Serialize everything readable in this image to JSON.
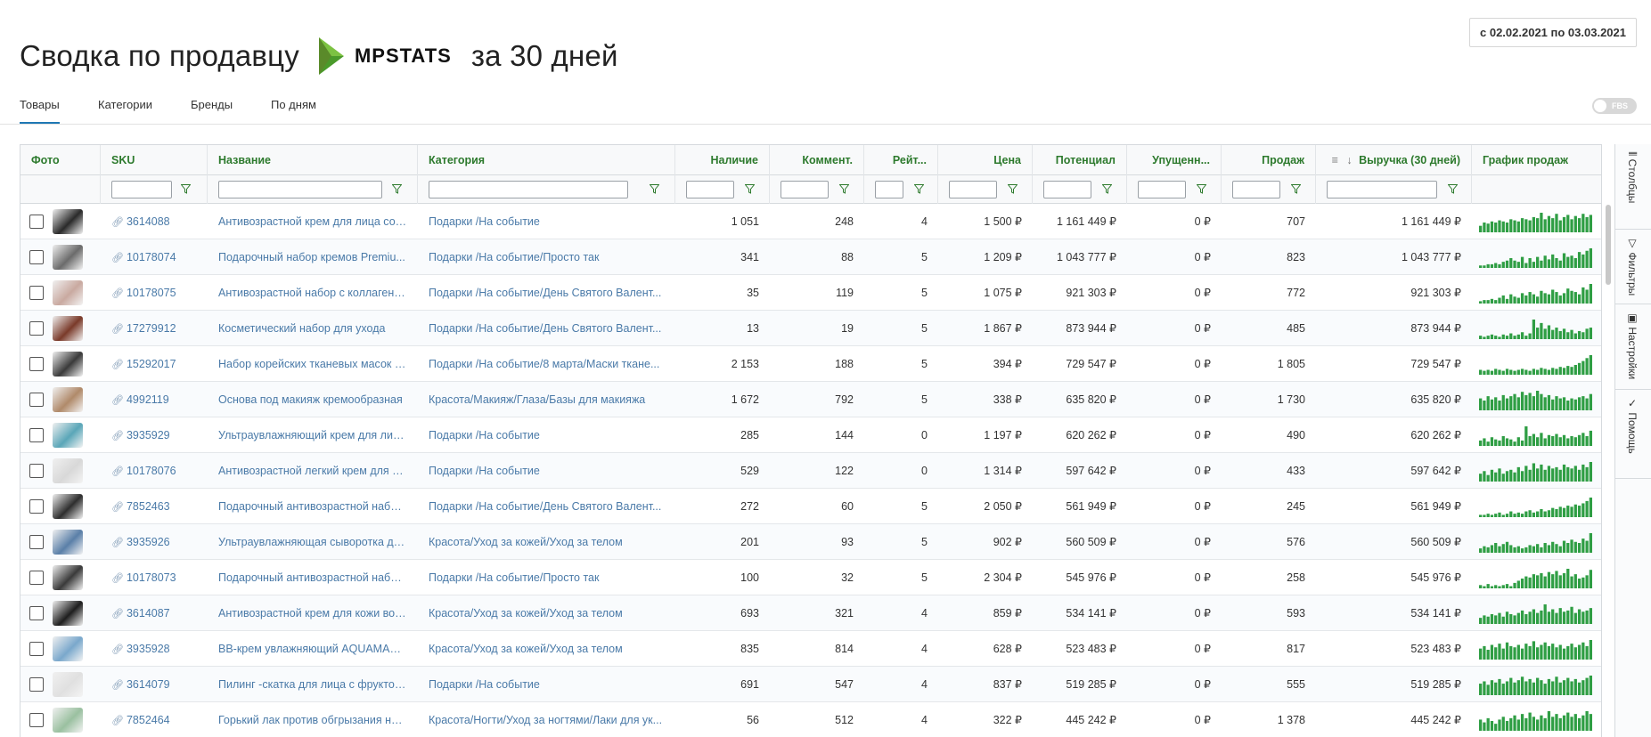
{
  "header": {
    "title_prefix": "Сводка по продавцу",
    "logo_text": "MPSTATS",
    "title_suffix": "за 30 дней",
    "date_range": "с 02.02.2021 по 03.03.2021"
  },
  "tabs": [
    {
      "label": "Товары",
      "active": true
    },
    {
      "label": "Категории",
      "active": false
    },
    {
      "label": "Бренды",
      "active": false
    },
    {
      "label": "По дням",
      "active": false
    }
  ],
  "fbs_toggle": {
    "label": "FBS",
    "on": false
  },
  "columns": {
    "photo": "Фото",
    "sku": "SKU",
    "name": "Название",
    "category": "Категория",
    "stock": "Наличие",
    "comments": "Коммент.",
    "rating": "Рейт...",
    "price": "Цена",
    "potential": "Потенциал",
    "lost": "Упущенн...",
    "sales": "Продаж",
    "revenue": "Выручка (30 дней)",
    "chart": "График продаж"
  },
  "side_panel": {
    "columns": "Столбцы",
    "filters": "Фильтры",
    "settings": "Настройки",
    "help": "Помощь"
  },
  "colors": {
    "accent_green": "#2f9e44",
    "header_green": "#2d7a2d",
    "link_blue": "#4a7aa8",
    "tab_underline": "#1f78b4"
  },
  "rows": [
    {
      "sku": "3614088",
      "name": "Антивозрастной крем для лица со з...",
      "category": "Подарки /На событие",
      "stock": "1 051",
      "comments": "248",
      "rating": "4",
      "price": "1 500 ₽",
      "potential": "1 161 449 ₽",
      "lost": "0 ₽",
      "sales": "707",
      "revenue": "1 161 449 ₽",
      "photo_color": "#2a2a2a",
      "spark": [
        6,
        9,
        8,
        10,
        9,
        11,
        10,
        9,
        12,
        11,
        10,
        13,
        12,
        11,
        14,
        13,
        18,
        12,
        15,
        13,
        17,
        11,
        14,
        16,
        12,
        15,
        13,
        17,
        14,
        16
      ]
    },
    {
      "sku": "10178074",
      "name": "Подарочный набор кремов Premiu...",
      "category": "Подарки /На событие/Просто так",
      "stock": "341",
      "comments": "88",
      "rating": "5",
      "price": "1 209 ₽",
      "potential": "1 043 777 ₽",
      "lost": "0 ₽",
      "sales": "823",
      "revenue": "1 043 777 ₽",
      "photo_color": "#6b6b6b",
      "spark": [
        2,
        2,
        3,
        3,
        4,
        3,
        5,
        6,
        8,
        6,
        5,
        9,
        4,
        8,
        5,
        9,
        6,
        10,
        7,
        11,
        8,
        6,
        12,
        9,
        10,
        8,
        13,
        11,
        14,
        16
      ]
    },
    {
      "sku": "10178075",
      "name": "Антивозрастной набор с коллагено...",
      "category": "Подарки /На событие/День Святого Валент...",
      "stock": "35",
      "comments": "119",
      "rating": "5",
      "price": "1 075 ₽",
      "potential": "921 303 ₽",
      "lost": "0 ₽",
      "sales": "772",
      "revenue": "921 303 ₽",
      "photo_color": "#c9a9a0",
      "spark": [
        2,
        3,
        3,
        4,
        3,
        5,
        7,
        4,
        8,
        6,
        5,
        9,
        7,
        10,
        8,
        6,
        11,
        9,
        8,
        12,
        10,
        7,
        9,
        13,
        11,
        10,
        8,
        14,
        12,
        17
      ]
    },
    {
      "sku": "17279912",
      "name": "Косметический набор для ухода",
      "category": "Подарки /На событие/День Святого Валент...",
      "stock": "13",
      "comments": "19",
      "rating": "5",
      "price": "1 867 ₽",
      "potential": "873 944 ₽",
      "lost": "0 ₽",
      "sales": "485",
      "revenue": "873 944 ₽",
      "photo_color": "#7a3a2a",
      "spark": [
        3,
        2,
        3,
        4,
        3,
        2,
        4,
        3,
        5,
        3,
        4,
        6,
        3,
        5,
        17,
        10,
        14,
        9,
        12,
        8,
        10,
        7,
        9,
        6,
        8,
        5,
        7,
        6,
        9,
        10
      ]
    },
    {
      "sku": "15292017",
      "name": "Набор корейских тканевых масок Ас...",
      "category": "Подарки /На событие/8 марта/Маски ткане...",
      "stock": "2 153",
      "comments": "188",
      "rating": "5",
      "price": "394 ₽",
      "potential": "729 547 ₽",
      "lost": "0 ₽",
      "sales": "1 805",
      "revenue": "729 547 ₽",
      "photo_color": "#3a3a3a",
      "spark": [
        5,
        4,
        5,
        4,
        6,
        5,
        4,
        6,
        5,
        4,
        5,
        6,
        5,
        4,
        6,
        5,
        7,
        6,
        5,
        7,
        6,
        8,
        7,
        9,
        8,
        10,
        12,
        14,
        17,
        20
      ]
    },
    {
      "sku": "4992119",
      "name": "Основа под макияж кремообразная",
      "category": "Красота/Макияж/Глаза/Базы для макияжа",
      "stock": "1 672",
      "comments": "792",
      "rating": "5",
      "price": "338 ₽",
      "potential": "635 820 ₽",
      "lost": "0 ₽",
      "sales": "1 730",
      "revenue": "635 820 ₽",
      "photo_color": "#b08a6a",
      "spark": [
        11,
        9,
        13,
        10,
        12,
        9,
        14,
        11,
        13,
        15,
        12,
        17,
        14,
        16,
        13,
        18,
        15,
        12,
        14,
        10,
        13,
        11,
        12,
        9,
        11,
        10,
        12,
        13,
        11,
        15
      ]
    },
    {
      "sku": "3935929",
      "name": "Ультраувлажняющий крем для лица...",
      "category": "Подарки /На событие",
      "stock": "285",
      "comments": "144",
      "rating": "0",
      "price": "1 197 ₽",
      "potential": "620 262 ₽",
      "lost": "0 ₽",
      "sales": "490",
      "revenue": "620 262 ₽",
      "photo_color": "#5aa6b8",
      "spark": [
        5,
        7,
        4,
        8,
        6,
        5,
        9,
        7,
        6,
        4,
        8,
        5,
        18,
        9,
        11,
        8,
        12,
        7,
        10,
        9,
        11,
        8,
        10,
        7,
        9,
        8,
        10,
        12,
        9,
        14
      ]
    },
    {
      "sku": "10178076",
      "name": "Антивозрастной легкий крем для ли...",
      "category": "Подарки /На событие",
      "stock": "529",
      "comments": "122",
      "rating": "0",
      "price": "1 314 ₽",
      "potential": "597 642 ₽",
      "lost": "0 ₽",
      "sales": "433",
      "revenue": "597 642 ₽",
      "photo_color": "#d8d8d8",
      "spark": [
        6,
        8,
        5,
        9,
        7,
        10,
        6,
        8,
        9,
        7,
        11,
        8,
        12,
        9,
        14,
        10,
        13,
        9,
        12,
        10,
        11,
        9,
        13,
        11,
        10,
        12,
        9,
        13,
        11,
        15
      ]
    },
    {
      "sku": "7852463",
      "name": "Подарочный антивозрастной набор...",
      "category": "Подарки /На событие/День Святого Валент...",
      "stock": "272",
      "comments": "60",
      "rating": "5",
      "price": "2 050 ₽",
      "potential": "561 949 ₽",
      "lost": "0 ₽",
      "sales": "245",
      "revenue": "561 949 ₽",
      "photo_color": "#2e2e2e",
      "spark": [
        2,
        2,
        3,
        2,
        3,
        4,
        2,
        3,
        5,
        3,
        4,
        3,
        5,
        6,
        4,
        5,
        7,
        5,
        6,
        8,
        7,
        9,
        8,
        10,
        9,
        11,
        10,
        12,
        14,
        17
      ]
    },
    {
      "sku": "3935926",
      "name": "Ультраувлажняющая сыворотка для ...",
      "category": "Красота/Уход за кожей/Уход за телом",
      "stock": "201",
      "comments": "93",
      "rating": "5",
      "price": "902 ₽",
      "potential": "560 509 ₽",
      "lost": "0 ₽",
      "sales": "576",
      "revenue": "560 509 ₽",
      "photo_color": "#5a7fa8",
      "spark": [
        4,
        6,
        5,
        7,
        9,
        6,
        8,
        10,
        7,
        5,
        6,
        4,
        5,
        7,
        6,
        8,
        5,
        9,
        7,
        10,
        8,
        6,
        11,
        9,
        12,
        10,
        9,
        13,
        11,
        18
      ]
    },
    {
      "sku": "10178073",
      "name": "Подарочный антивозрастной набор...",
      "category": "Подарки /На событие/Просто так",
      "stock": "100",
      "comments": "32",
      "rating": "5",
      "price": "2 304 ₽",
      "potential": "545 976 ₽",
      "lost": "0 ₽",
      "sales": "258",
      "revenue": "545 976 ₽",
      "photo_color": "#3a3a3a",
      "spark": [
        3,
        2,
        4,
        2,
        3,
        2,
        3,
        4,
        2,
        5,
        7,
        9,
        11,
        10,
        13,
        12,
        14,
        11,
        15,
        13,
        16,
        12,
        14,
        18,
        11,
        13,
        9,
        10,
        12,
        17
      ]
    },
    {
      "sku": "3614087",
      "name": "Антивозрастной крем для кожи вок...",
      "category": "Красота/Уход за кожей/Уход за телом",
      "stock": "693",
      "comments": "321",
      "rating": "4",
      "price": "859 ₽",
      "potential": "534 141 ₽",
      "lost": "0 ₽",
      "sales": "593",
      "revenue": "534 141 ₽",
      "photo_color": "#1e1e1e",
      "spark": [
        5,
        7,
        6,
        8,
        7,
        9,
        6,
        10,
        8,
        7,
        9,
        11,
        8,
        10,
        12,
        9,
        11,
        16,
        10,
        12,
        9,
        13,
        10,
        11,
        14,
        9,
        12,
        10,
        11,
        13
      ]
    },
    {
      "sku": "3935928",
      "name": "BB-крем увлажняющий AQUAMAX ...",
      "category": "Красота/Уход за кожей/Уход за телом",
      "stock": "835",
      "comments": "814",
      "rating": "4",
      "price": "628 ₽",
      "potential": "523 483 ₽",
      "lost": "0 ₽",
      "sales": "817",
      "revenue": "523 483 ₽",
      "photo_color": "#7aa8cc",
      "spark": [
        9,
        11,
        8,
        12,
        10,
        13,
        9,
        14,
        11,
        10,
        12,
        9,
        13,
        11,
        15,
        10,
        12,
        14,
        11,
        13,
        10,
        12,
        9,
        11,
        13,
        10,
        12,
        14,
        11,
        16
      ]
    },
    {
      "sku": "3614079",
      "name": "Пилинг -скатка для лица с фруктовы...",
      "category": "Подарки /На событие",
      "stock": "691",
      "comments": "547",
      "rating": "4",
      "price": "837 ₽",
      "potential": "519 285 ₽",
      "lost": "0 ₽",
      "sales": "555",
      "revenue": "519 285 ₽",
      "photo_color": "#e0e0e0",
      "spark": [
        10,
        12,
        9,
        13,
        11,
        14,
        10,
        12,
        15,
        11,
        13,
        16,
        12,
        14,
        11,
        15,
        13,
        10,
        14,
        12,
        16,
        11,
        13,
        15,
        12,
        14,
        11,
        13,
        15,
        17
      ]
    },
    {
      "sku": "7852464",
      "name": "Горький лак против обгрызания ног...",
      "category": "Красота/Ногти/Уход за ногтями/Лаки для ук...",
      "stock": "56",
      "comments": "512",
      "rating": "4",
      "price": "322 ₽",
      "potential": "445 242 ₽",
      "lost": "0 ₽",
      "sales": "1 378",
      "revenue": "445 242 ₽",
      "photo_color": "#9ac0a0",
      "spark": [
        8,
        6,
        9,
        7,
        5,
        8,
        10,
        7,
        9,
        11,
        8,
        12,
        9,
        13,
        10,
        8,
        11,
        9,
        14,
        10,
        12,
        9,
        11,
        13,
        10,
        12,
        9,
        11,
        14,
        12
      ]
    }
  ]
}
